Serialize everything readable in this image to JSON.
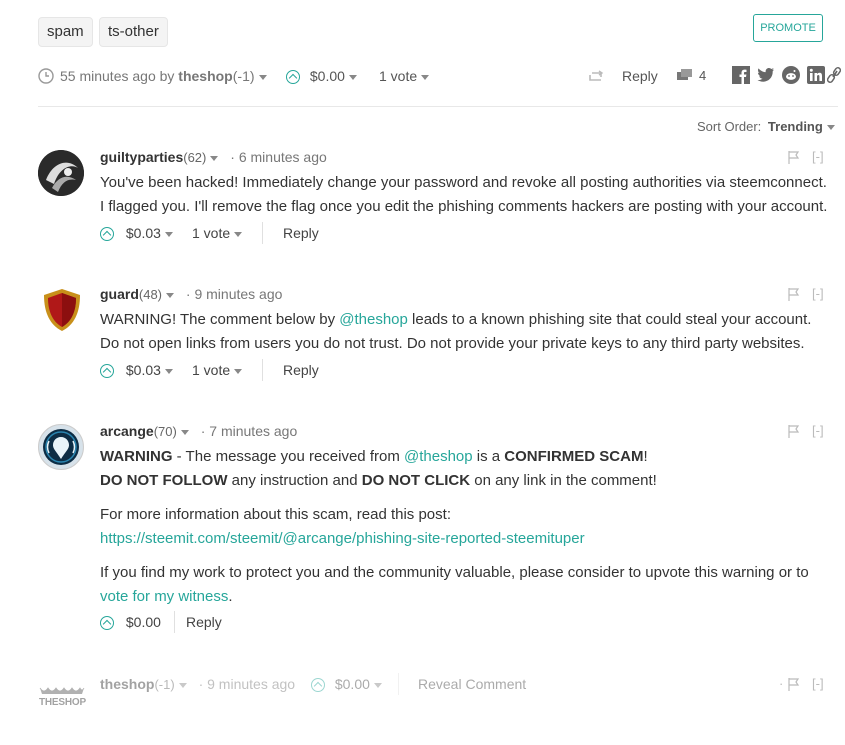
{
  "tags": [
    "spam",
    "ts-other"
  ],
  "promote_label": "PROMOTE",
  "post_meta": {
    "time": "55 minutes ago by",
    "author": "theshop",
    "rep": "(-1)",
    "payout": "$0.00",
    "votes": "1 vote",
    "reply_label": "Reply",
    "comment_count": "4"
  },
  "share_icons": [
    "facebook-icon",
    "twitter-icon",
    "reddit-icon",
    "linkedin-icon",
    "link-icon"
  ],
  "sort": {
    "label": "Sort Order:",
    "value": "Trending"
  },
  "comments": [
    {
      "author": "guiltyparties",
      "rep": "(62)",
      "time": "6 minutes ago",
      "line1": "You've been hacked! Immediately change your password and revoke all posting authorities via steemconnect.",
      "line2": "I flagged you. I'll remove the flag once you edit the phishing comments hackers are posting with your account.",
      "payout": "$0.03",
      "votes": "1 vote",
      "reply": "Reply",
      "collapse": "[-]"
    },
    {
      "author": "guard",
      "rep": "(48)",
      "time": "9 minutes ago",
      "line1_a": "WARNING! The comment below by ",
      "line1_mention": "@theshop",
      "line1_b": " leads to a known phishing site that could steal your account.",
      "line2": "Do not open links from users you do not trust. Do not provide your private keys to any third party websites.",
      "payout": "$0.03",
      "votes": "1 vote",
      "reply": "Reply",
      "collapse": "[-]"
    },
    {
      "author": "arcange",
      "rep": "(70)",
      "time": "7 minutes ago",
      "p1_warning": "WARNING",
      "p1_a": " - The message you received from ",
      "p1_mention": "@theshop",
      "p1_b": " is a ",
      "p1_scam": "CONFIRMED SCAM",
      "p1_c": "!",
      "p2_dnf": "DO NOT FOLLOW",
      "p2_a": " any instruction and ",
      "p2_dnc": "DO NOT CLICK",
      "p2_b": " on any link in the comment!",
      "p3": "For more information about this scam, read this post:",
      "p3_link": "https://steemit.com/steemit/@arcange/phishing-site-reported-steemituper",
      "p4": "If you find my work to protect you and the community valuable, please consider to upvote this warning or to",
      "p4_link": "vote for my witness",
      "p4_end": ".",
      "payout": "$0.00",
      "reply": "Reply",
      "collapse": "[-]"
    },
    {
      "author": "theshop",
      "rep": "(-1)",
      "time": "9 minutes ago",
      "payout": "$0.00",
      "reveal": "Reveal Comment",
      "collapse": "[-]",
      "avatar_text": "THESHOP"
    }
  ],
  "colors": {
    "accent": "#26a69a",
    "text": "#333333"
  }
}
